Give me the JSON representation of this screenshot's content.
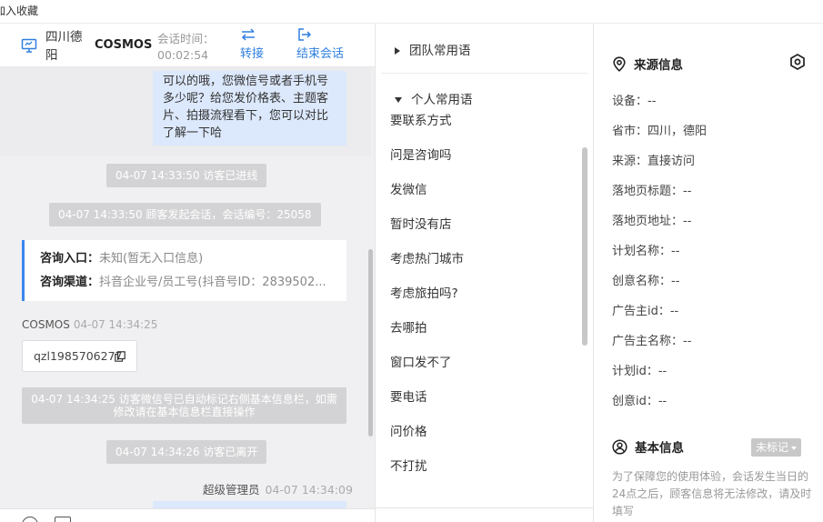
{
  "top": {
    "label": "加入收藏"
  },
  "header": {
    "location": "四川德阳",
    "brand": "COSMOS",
    "session_time_label": "会话时间：",
    "session_time_value": "00:02:54",
    "transfer_label": "转接",
    "end_label": "结束会话"
  },
  "chat": {
    "bubble_text": "可以的哦，您微信号或者手机号多少呢？给您发价格表、主题客片、拍摄流程看下，您可以对比了解一下哈",
    "sys_enter": "04-07 14:33:50 访客已进线",
    "sys_start": "04-07 14:33:50 顾客发起会话，会话编号：25058",
    "info": {
      "entry_label": "咨询入口：",
      "entry_value": "未知(暂无入口信息)",
      "channel_label": "咨询渠道：",
      "channel_value": "抖音企业号/员工号(抖音号ID：2839502..."
    },
    "sender_name": "COSMOS",
    "sender_time": "04-07 14:34:25",
    "wechat_id": "qzl1985706277",
    "sys_marked": "04-07 14:34:25 访客微信号已自动标记右侧基本信息栏，如需修改请在基本信息栏直接操作",
    "sys_left": "04-07 14:34:26 访客已离开",
    "admin_name": "超级管理员",
    "admin_time": "04-07 14:34:09"
  },
  "phrases": {
    "team_group": "团队常用语",
    "personal_group": "个人常用语",
    "items": [
      "要联系方式",
      "问是咨询吗",
      "发微信",
      "暂时没有店",
      "考虑热门城市",
      "考虑旅拍吗?",
      "去哪拍",
      "窗口发不了",
      "要电话",
      "问价格",
      "不打扰"
    ]
  },
  "source": {
    "title": "来源信息",
    "device": "设备：--",
    "province": "省市：四川，德阳",
    "origin": "来源：直接访问",
    "landing_title": "落地页标题：--",
    "landing_url": "落地页地址：--",
    "plan_name": "计划名称：--",
    "creative_name": "创意名称：--",
    "advertiser_id": "广告主id：--",
    "advertiser_name": "广告主名称：--",
    "plan_id": "计划id：--",
    "creative_id": "创意id：--"
  },
  "basic": {
    "title": "基本信息",
    "badge": "未标记",
    "notice": "为了保障您的使用体验，会话发生当日的24点之后，顾客信息将无法修改，请及时填写"
  },
  "colors": {
    "accent": "#2f7fe0",
    "bubble": "#dce8fb",
    "system": "#d3d3d5"
  }
}
